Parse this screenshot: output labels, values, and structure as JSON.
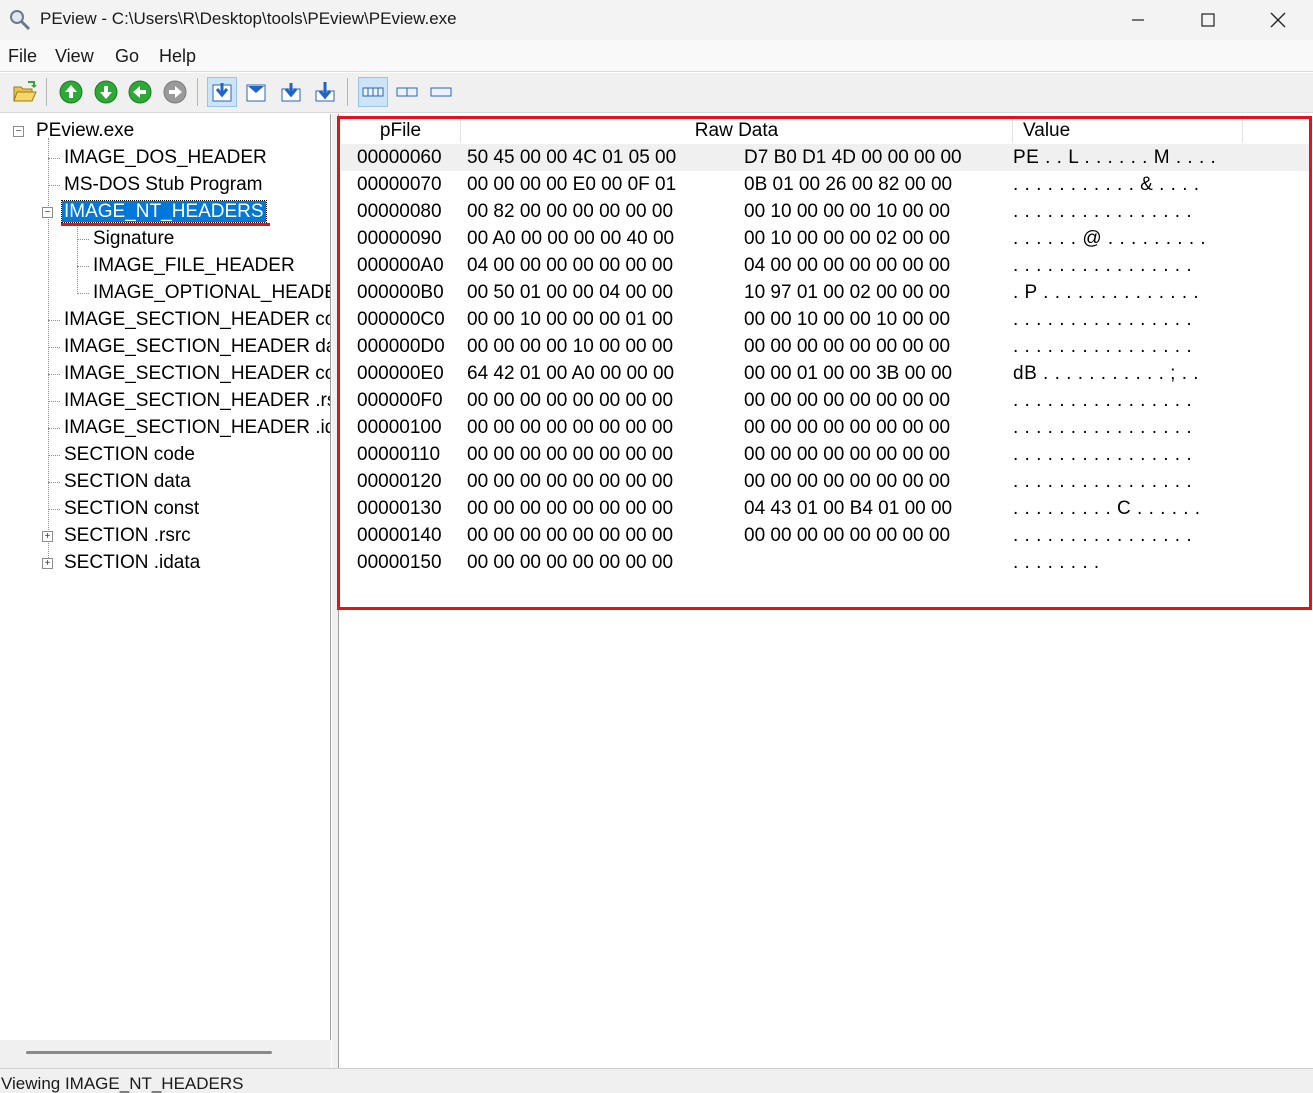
{
  "window": {
    "title": "PEview - C:\\Users\\R\\Desktop\\tools\\PEview\\PEview.exe",
    "icon": "magnifier-icon"
  },
  "menu": {
    "items": [
      "File",
      "View",
      "Go",
      "Help"
    ]
  },
  "toolbar": {
    "buttons": [
      {
        "name": "open-file-icon"
      },
      {
        "name": "go-up-icon",
        "color": "#2ea836"
      },
      {
        "name": "go-down-icon",
        "color": "#2ea836"
      },
      {
        "name": "go-back-icon",
        "color": "#2ea836"
      },
      {
        "name": "go-forward-icon",
        "color": "#9a9a9a"
      },
      {
        "name": "view-first-icon"
      },
      {
        "name": "view-header-icon"
      },
      {
        "name": "view-next-icon"
      },
      {
        "name": "view-last-icon"
      },
      {
        "name": "hex-view-icon"
      },
      {
        "name": "byte-view-icon"
      },
      {
        "name": "word-view-icon"
      }
    ]
  },
  "tree": {
    "root": "PEview.exe",
    "items": [
      "IMAGE_DOS_HEADER",
      "MS-DOS Stub Program",
      "IMAGE_NT_HEADERS",
      "Signature",
      "IMAGE_FILE_HEADER",
      "IMAGE_OPTIONAL_HEADER",
      "IMAGE_SECTION_HEADER code",
      "IMAGE_SECTION_HEADER data",
      "IMAGE_SECTION_HEADER const",
      "IMAGE_SECTION_HEADER .rsrc",
      "IMAGE_SECTION_HEADER .idata",
      "SECTION code",
      "SECTION data",
      "SECTION const",
      "SECTION .rsrc",
      "SECTION .idata"
    ],
    "selected": "IMAGE_NT_HEADERS"
  },
  "hex": {
    "headers": {
      "pfile": "pFile",
      "raw": "Raw Data",
      "value": "Value"
    },
    "rows": [
      {
        "pfile": "00000060",
        "raw1": "50  45  00  00  4C  01  05  00",
        "raw2": "D7  B0  D1  4D  00  00  00  00",
        "value": "PE . . L . . . . . . M . . . ."
      },
      {
        "pfile": "00000070",
        "raw1": "00  00  00  00  E0  00  0F  01",
        "raw2": "0B  01  00  26  00  82  00  00",
        "value": ". . . . . . . . . . . & . . . ."
      },
      {
        "pfile": "00000080",
        "raw1": "00  82  00  00  00  00  00  00",
        "raw2": "00  10  00  00  00  10  00  00",
        "value": ". . . . . . . . . . . . . . . ."
      },
      {
        "pfile": "00000090",
        "raw1": "00  A0  00  00  00  00  40  00",
        "raw2": "00  10  00  00  00  02  00  00",
        "value": ". . . . . . @ . . . . . . . . ."
      },
      {
        "pfile": "000000A0",
        "raw1": "04  00  00  00  00  00  00  00",
        "raw2": "04  00  00  00  00  00  00  00",
        "value": ". . . . . . . . . . . . . . . ."
      },
      {
        "pfile": "000000B0",
        "raw1": "00  50  01  00  00  04  00  00",
        "raw2": "10  97  01  00  02  00  00  00",
        "value": ". P . . . . . . . . . . . . . ."
      },
      {
        "pfile": "000000C0",
        "raw1": "00  00  10  00  00  00  01  00",
        "raw2": "00  00  10  00  00  10  00  00",
        "value": ". . . . . . . . . . . . . . . ."
      },
      {
        "pfile": "000000D0",
        "raw1": "00  00  00  00  10  00  00  00",
        "raw2": "00  00  00  00  00  00  00  00",
        "value": ". . . . . . . . . . . . . . . ."
      },
      {
        "pfile": "000000E0",
        "raw1": "64  42  01  00  A0  00  00  00",
        "raw2": "00  00  01  00  00  3B  00  00",
        "value": "dB . . . . . . . . . . . ; . ."
      },
      {
        "pfile": "000000F0",
        "raw1": "00  00  00  00  00  00  00  00",
        "raw2": "00  00  00  00  00  00  00  00",
        "value": ". . . . . . . . . . . . . . . ."
      },
      {
        "pfile": "00000100",
        "raw1": "00  00  00  00  00  00  00  00",
        "raw2": "00  00  00  00  00  00  00  00",
        "value": ". . . . . . . . . . . . . . . ."
      },
      {
        "pfile": "00000110",
        "raw1": "00  00  00  00  00  00  00  00",
        "raw2": "00  00  00  00  00  00  00  00",
        "value": ". . . . . . . . . . . . . . . ."
      },
      {
        "pfile": "00000120",
        "raw1": "00  00  00  00  00  00  00  00",
        "raw2": "00  00  00  00  00  00  00  00",
        "value": ". . . . . . . . . . . . . . . ."
      },
      {
        "pfile": "00000130",
        "raw1": "00  00  00  00  00  00  00  00",
        "raw2": "04  43  01  00  B4  01  00  00",
        "value": ". . . . . . . . . C . . . . . ."
      },
      {
        "pfile": "00000140",
        "raw1": "00  00  00  00  00  00  00  00",
        "raw2": "00  00  00  00  00  00  00  00",
        "value": ". . . . . . . . . . . . . . . ."
      },
      {
        "pfile": "00000150",
        "raw1": "00  00  00  00  00  00  00  00",
        "raw2": "",
        "value": ". . . . . . . ."
      }
    ],
    "annotation_color": "#e0121a"
  },
  "status": {
    "text": "Viewing IMAGE_NT_HEADERS"
  }
}
